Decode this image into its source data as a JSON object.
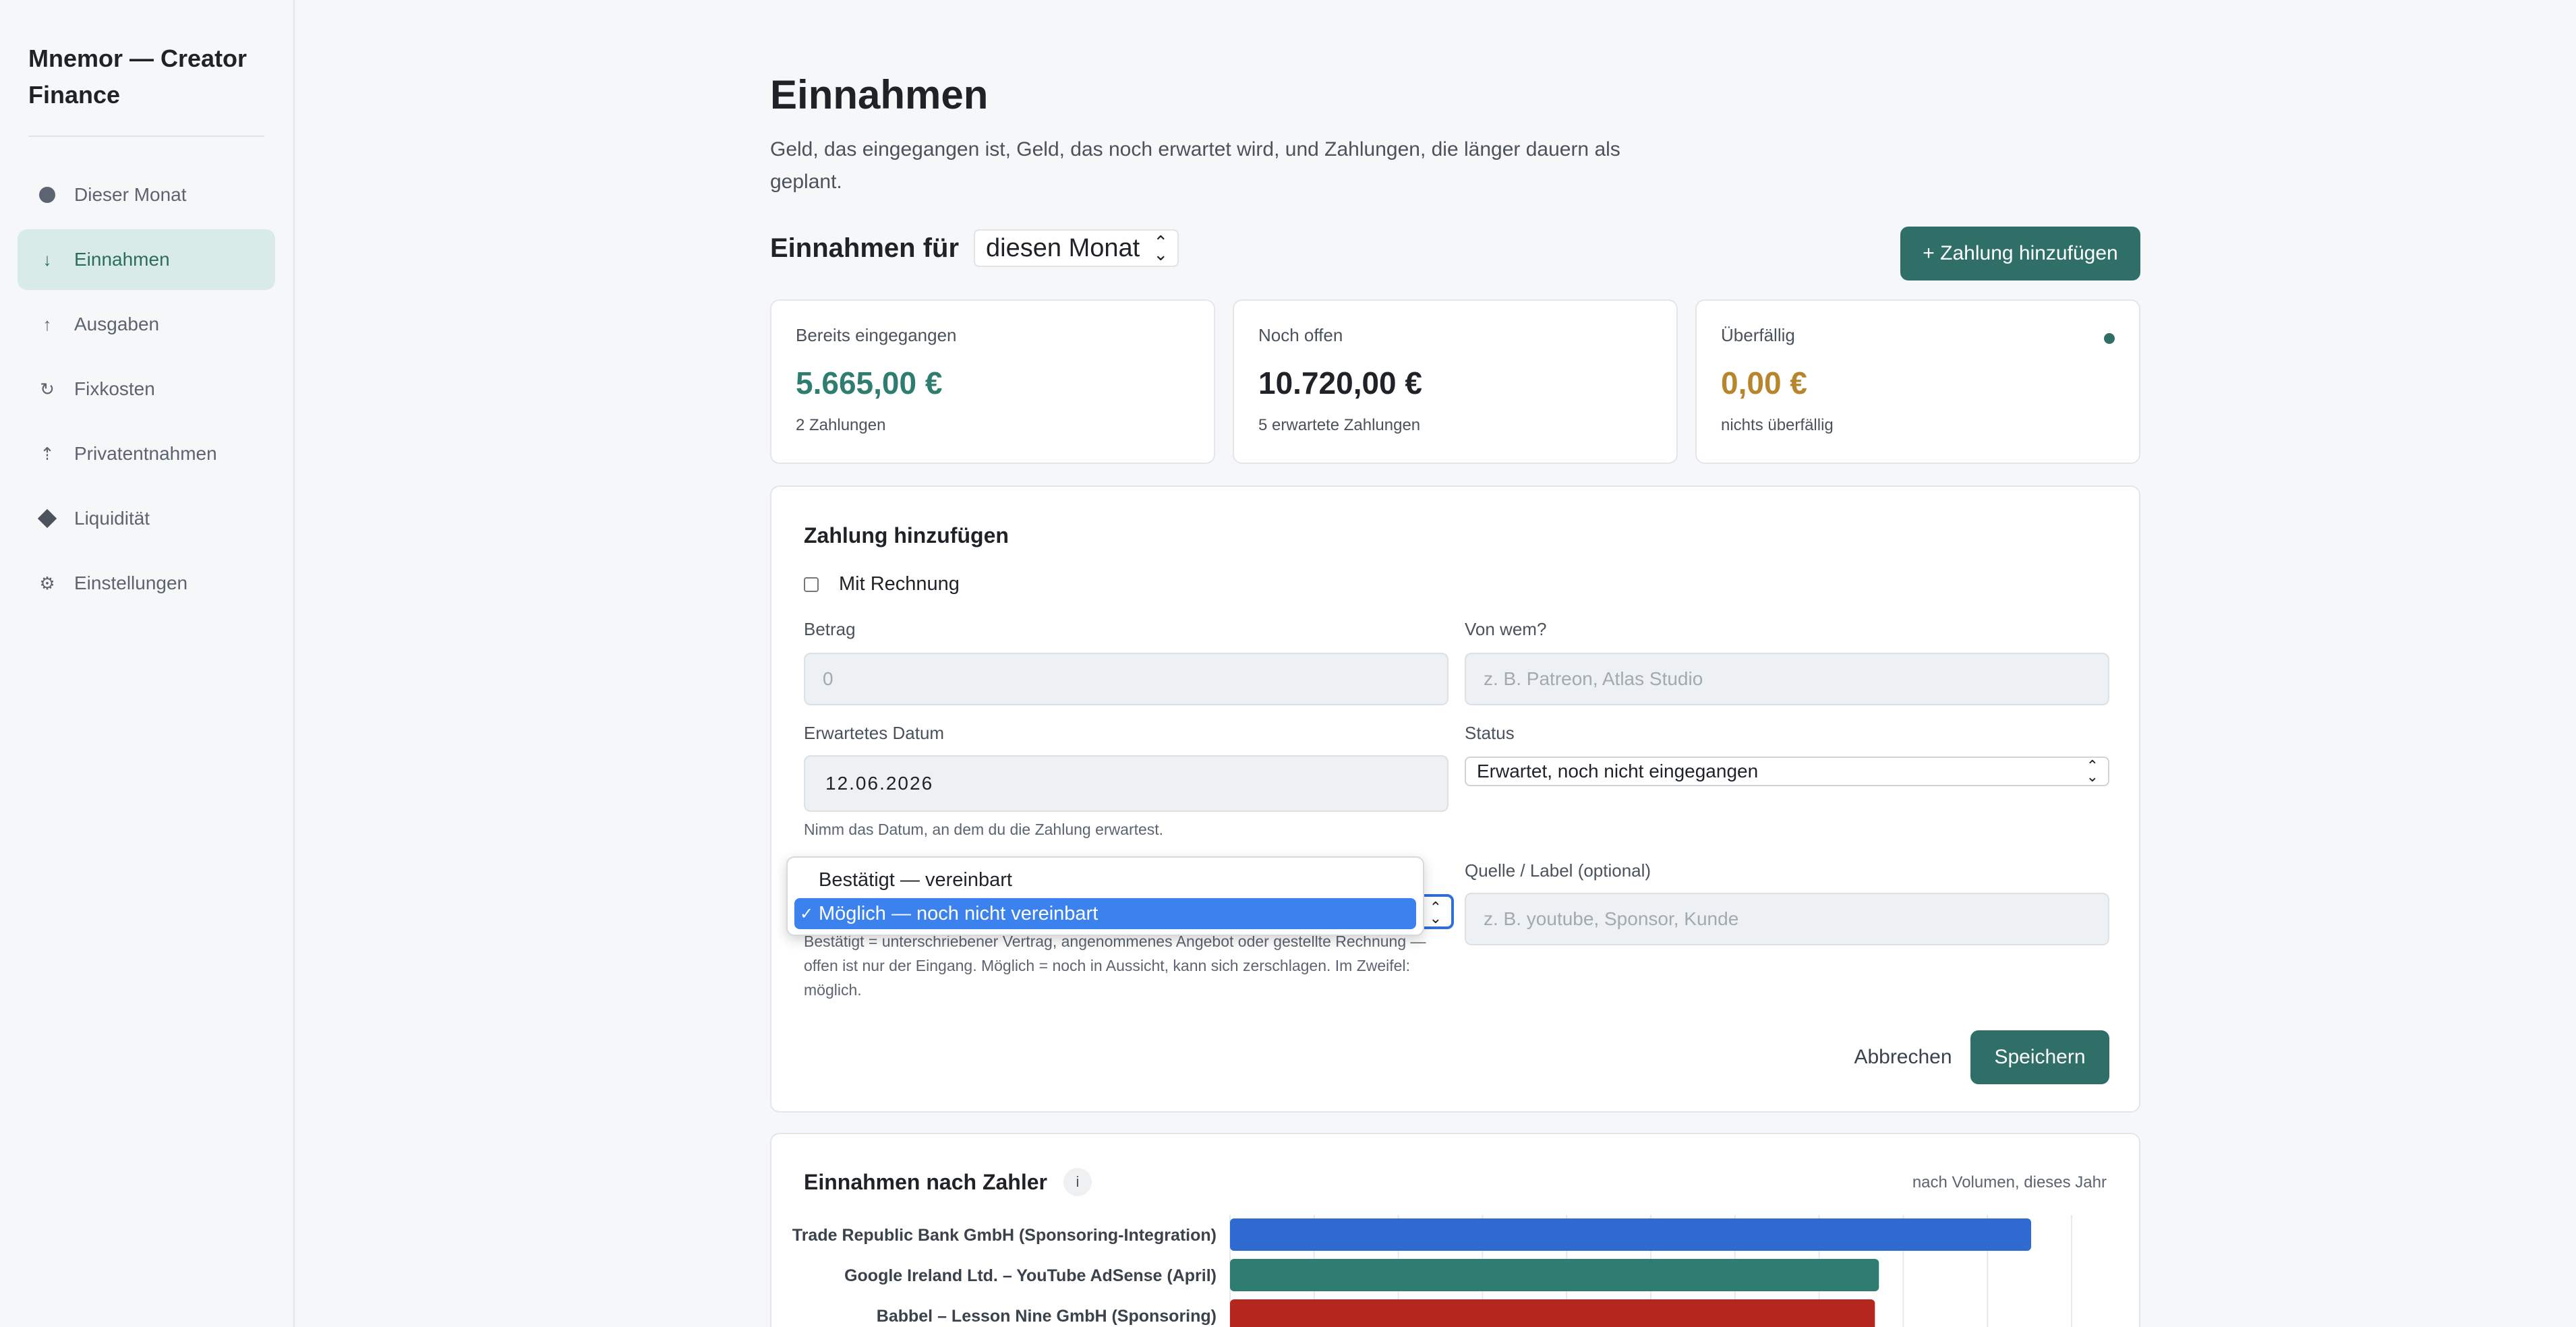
{
  "sidebar": {
    "brand": "Mnemor — Creator Finance",
    "items": [
      {
        "label": "Dieser Monat",
        "icon": "dot-icon",
        "active": false
      },
      {
        "label": "Einnahmen",
        "icon": "arrow-down-icon",
        "active": true
      },
      {
        "label": "Ausgaben",
        "icon": "arrow-up-icon",
        "active": false
      },
      {
        "label": "Fixkosten",
        "icon": "refresh-icon",
        "active": false
      },
      {
        "label": "Privatentnahmen",
        "icon": "withdraw-icon",
        "active": false
      },
      {
        "label": "Liquidität",
        "icon": "diamond-icon",
        "active": false
      },
      {
        "label": "Einstellungen",
        "icon": "gear-icon",
        "active": false
      }
    ]
  },
  "page": {
    "title": "Einnahmen",
    "subtitle": "Geld, das eingegangen ist, Geld, das noch erwartet wird, und Zahlungen, die länger dauern als geplant.",
    "section_title": "Einnahmen für",
    "period_value": "diesen Monat",
    "add_button": "+ Zahlung hinzufügen"
  },
  "cards": [
    {
      "label": "Bereits eingegangen",
      "value": "5.665,00 €",
      "meta": "2 Zahlungen",
      "tone": "#2f7d70"
    },
    {
      "label": "Noch offen",
      "value": "10.720,00 €",
      "meta": "5 erwartete Zahlungen",
      "tone": "#1f2328"
    },
    {
      "label": "Überfällig",
      "value": "0,00 €",
      "meta": "nichts überfällig",
      "tone": "#b7852b"
    }
  ],
  "form": {
    "title": "Zahlung hinzufügen",
    "checkbox_label": "Mit Rechnung",
    "amount_label": "Betrag",
    "amount_placeholder": "0",
    "from_label": "Von wem?",
    "from_placeholder": "z. B. Patreon, Atlas Studio",
    "date_label": "Erwartetes Datum",
    "date_value": "12.06.2026",
    "date_hint": "Nimm das Datum, an dem du die Zahlung erwartest.",
    "status_label": "Status",
    "status_value": "Erwartet, noch nicht eingegangen",
    "source_label": "Quelle / Label",
    "source_optional": "(optional)",
    "source_placeholder": "z. B. youtube, Sponsor, Kunde",
    "confidence_hint": "Bestätigt = unterschriebener Vertrag, angenommenes Angebot oder gestellte Rechnung — offen ist nur der Eingang. Möglich = noch in Aussicht, kann sich zerschlagen. Im Zweifel: möglich.",
    "dropdown_options": [
      "Bestätigt — vereinbart",
      "Möglich — noch nicht vereinbart"
    ],
    "dropdown_selected_index": 1,
    "check_mark": "✓",
    "cancel": "Abbrechen",
    "save": "Speichern"
  },
  "chart_panel": {
    "title": "Einnahmen nach Zahler",
    "info": "i",
    "meta": "nach Volumen, dieses Jahr"
  },
  "chart_data": {
    "type": "bar",
    "orientation": "horizontal",
    "title": "Einnahmen nach Zahler",
    "grid": true,
    "categories": [
      "Trade Republic Bank GmbH (Sponsoring-Integration)",
      "Google Ireland Ltd. – YouTube AdSense (April)",
      "Babbel – Lesson Nine GmbH (Sponsoring)"
    ],
    "values": [
      100,
      81,
      80.5
    ],
    "colors": [
      "#2f6ad0",
      "#2f7d70",
      "#b5261e"
    ]
  }
}
